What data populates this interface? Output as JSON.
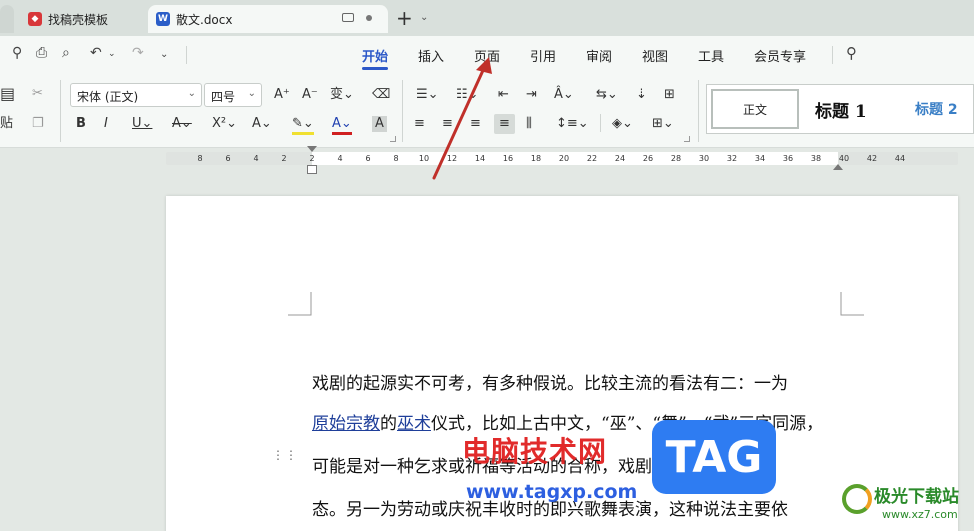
{
  "tabs": [
    {
      "label": "找稿壳模板"
    },
    {
      "label": "散文.docx"
    }
  ],
  "menu": {
    "items": [
      "开始",
      "插入",
      "页面",
      "引用",
      "审阅",
      "视图",
      "工具",
      "会员专享"
    ],
    "active": "开始"
  },
  "ribbon": {
    "font_name": "宋体 (正文)",
    "font_size": "四号",
    "paste_label": "贴",
    "styles": {
      "normal": "正文",
      "heading1": "标题 1",
      "heading2": "标题 2"
    }
  },
  "ruler": {
    "ticks": [
      "8",
      "6",
      "4",
      "2",
      "2",
      "4",
      "6",
      "8",
      "10",
      "12",
      "14",
      "16",
      "18",
      "20",
      "22",
      "24",
      "26",
      "28",
      "30",
      "32",
      "34",
      "36",
      "38",
      "40",
      "42",
      "44"
    ]
  },
  "document": {
    "line1": "戏剧的起源实不可考，有多种假说。比较主流的看法有二：一为",
    "line2_link1": "原始宗教",
    "line2_mid": "的",
    "line2_link2": "巫术",
    "line2_rest": "仪式，比如上古中文，“巫”、“舞”、“武”三字同源，",
    "line3": "可能是对一种乞求或祈福等活动的合称，戏剧的原始形",
    "line4": "态。另一为劳动或庆祝丰收时的即兴歌舞表演，这种说法主要依"
  },
  "watermarks": {
    "site_cn": "电脑技术网",
    "site_url": "www.tagxp.com",
    "tag": "TAG",
    "corner_cn": "极光下载站",
    "corner_url": "www.xz7.com"
  },
  "colors": {
    "accent": "#2c58c8",
    "arrow": "#c0302a"
  }
}
